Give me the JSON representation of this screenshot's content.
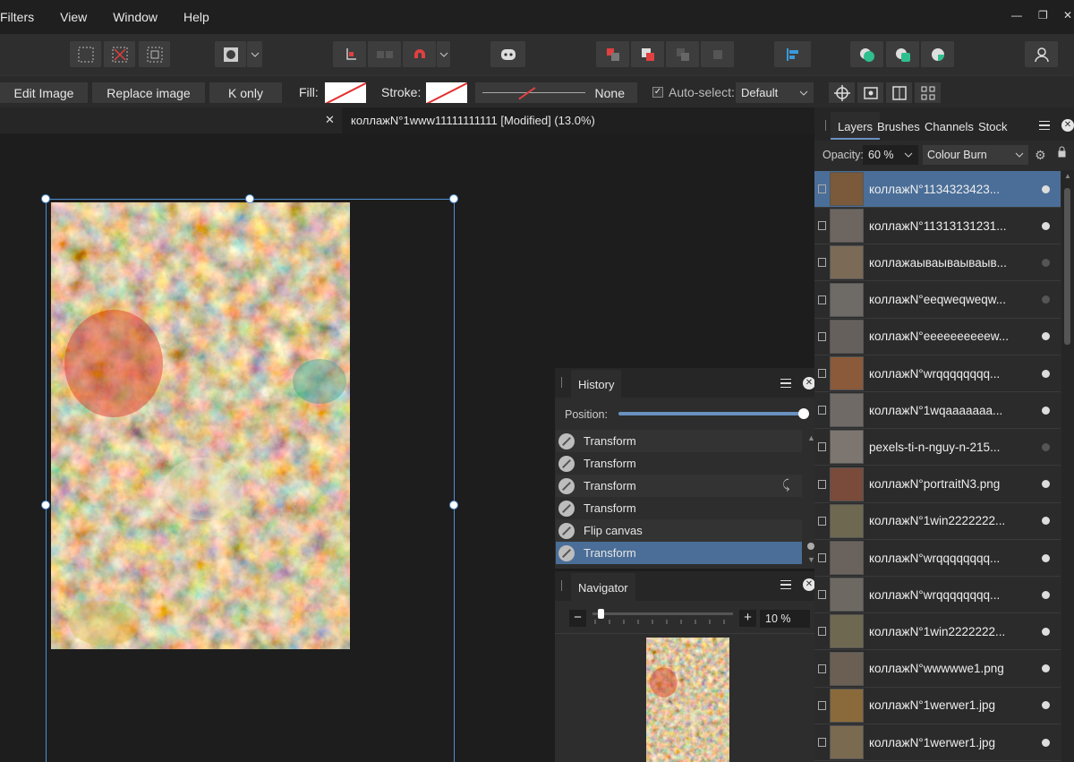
{
  "menu": [
    "Filters",
    "View",
    "Window",
    "Help"
  ],
  "window_controls": {
    "minimize": "—",
    "restore": "❐",
    "close": "✕"
  },
  "context": {
    "edit_image": "Edit Image",
    "replace_image": "Replace image",
    "k_only": "K only",
    "fill_label": "Fill:",
    "stroke_label": "Stroke:",
    "stroke_none": "None",
    "autoselect_label": "Auto-select:",
    "autoselect_value": "Default"
  },
  "document": {
    "tab_close": "✕",
    "title": "коллажN°1www11111111111 [Modified] (13.0%)"
  },
  "history": {
    "tab": "History",
    "position_label": "Position:",
    "items": [
      "Transform",
      "Transform",
      "Transform",
      "Transform",
      "Flip canvas",
      "Transform"
    ]
  },
  "navigator": {
    "tab": "Navigator",
    "zoom": "10 %",
    "minus": "−",
    "plus": "+"
  },
  "layers_panel": {
    "tabs": [
      "Layers",
      "Brushes",
      "Channels",
      "Stock"
    ],
    "opacity_label": "Opacity:",
    "opacity_value": "60 %",
    "blend_mode": "Colour Burn",
    "layers": [
      "коллажN°1134323423...",
      "коллажN°11313131231...",
      "коллажаываываываыв...",
      "коллажN°eeqweqweqw...",
      "коллажN°eeeeeeeeeew...",
      "коллажN°wrqqqqqqqq...",
      "коллажN°1wqaaaaaaa...",
      "pexels-ti-n-nguy-n-215...",
      "коллажN°portraitN3.png",
      "коллажN°1win2222222...",
      "коллажN°wrqqqqqqqq...",
      "коллажN°wrqqqqqqqq...",
      "коллажN°1win2222222...",
      "коллажN°wwwwwe1.png",
      "коллажN°1werwer1.jpg",
      "коллажN°1werwer1.jpg"
    ]
  },
  "colors": {
    "accent": "#4a6e98",
    "selection": "#4d8fd6"
  }
}
